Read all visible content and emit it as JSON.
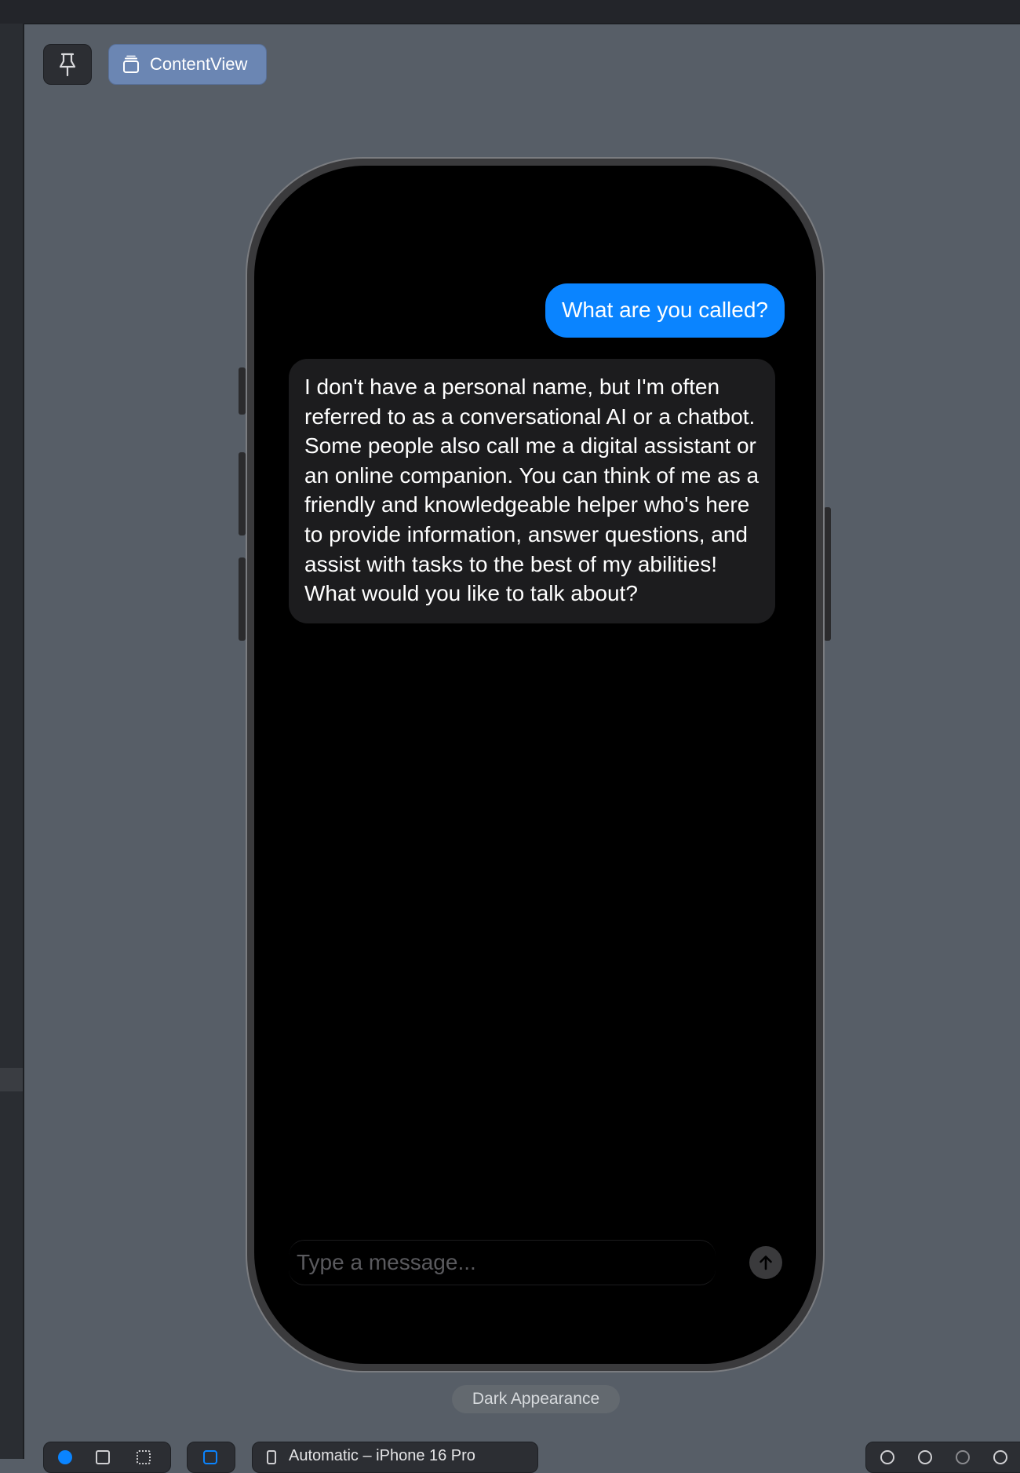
{
  "canvas": {
    "pin_icon": "pin-icon",
    "content_view_label": "ContentView",
    "content_view_icon": "stack-icon"
  },
  "chat": {
    "user_message": "What are you called?",
    "bot_message": "I don't have a personal name, but I'm often referred to as a conversational AI or a chatbot. Some people also call me a digital assistant or an online companion. You can think of me as a friendly and knowledgeable helper who's here to provide information, answer questions, and assist with tasks to the best of my abilities! What would you like to talk about?",
    "input_placeholder": "Type a message...",
    "send_icon": "arrow-up-circle-icon"
  },
  "preview": {
    "appearance_label": "Dark Appearance",
    "device_label": "Automatic – iPhone 16 Pro"
  },
  "colors": {
    "user_bubble": "#0a84ff",
    "bot_bubble": "#1c1c1e",
    "canvas_bg": "#575e67",
    "content_view_button": "#6b86b3"
  }
}
